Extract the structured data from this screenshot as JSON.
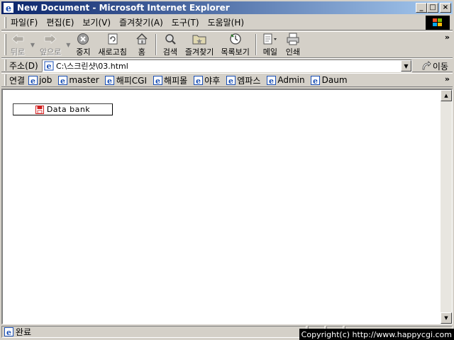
{
  "window": {
    "title": "New Document - Microsoft Internet Explorer",
    "minimize": "_",
    "maximize": "□",
    "close": "×"
  },
  "menu": [
    {
      "label": "파일(F)"
    },
    {
      "label": "편집(E)"
    },
    {
      "label": "보기(V)"
    },
    {
      "label": "즐겨찾기(A)"
    },
    {
      "label": "도구(T)"
    },
    {
      "label": "도움말(H)"
    }
  ],
  "toolbar": {
    "back": "뒤로",
    "forward": "앞으로",
    "stop": "중지",
    "refresh": "새로고침",
    "home": "홈",
    "search": "검색",
    "favorites": "즐겨찾기",
    "history": "목록보기",
    "mail": "메일",
    "print": "인쇄",
    "more": "»"
  },
  "address": {
    "label": "주소(D)",
    "value": "C:\\스크린샷\\03.html",
    "go": "이동"
  },
  "links": {
    "label": "연결",
    "items": [
      "job",
      "master",
      "해피CGI",
      "해피몰",
      "야후",
      "엠파스",
      "Admin",
      "Daum"
    ],
    "more": "»"
  },
  "content": {
    "databank_label": "Data bank"
  },
  "status": {
    "text": "완료"
  },
  "copyright": "Copyright(c) http://www.happycgi.com",
  "colors": {
    "titlebar_start": "#0a246a",
    "titlebar_end": "#a6caf0",
    "chrome": "#d4d0c8",
    "ie_blue": "#1a4fb5"
  }
}
